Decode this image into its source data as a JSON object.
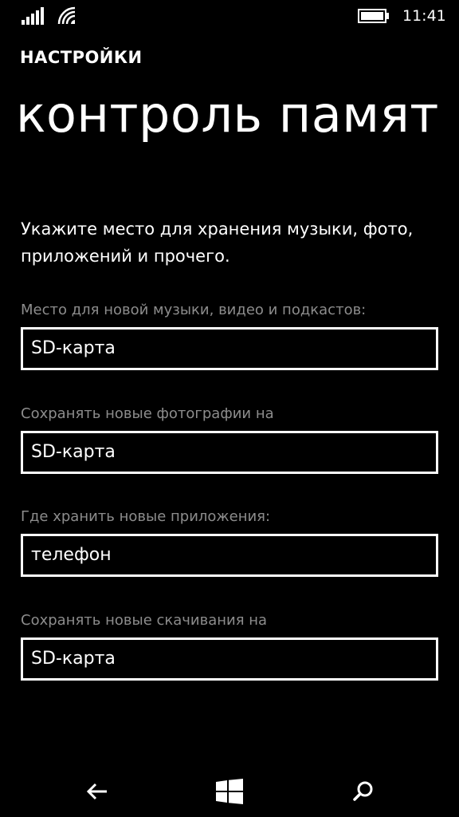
{
  "status_bar": {
    "time": "11:41",
    "icons": [
      "signal-icon",
      "wifi-icon",
      "battery-icon"
    ]
  },
  "header": {
    "app_name": "НАСТРОЙКИ",
    "page_title": "контроль памят"
  },
  "description": "Укажите место для хранения музыки, фото, приложений и прочего.",
  "settings": [
    {
      "label": "Место для новой музыки, видео и подкастов:",
      "value": "SD-карта"
    },
    {
      "label": "Сохранять новые фотографии на",
      "value": "SD-карта"
    },
    {
      "label": "Где хранить новые приложения:",
      "value": "телефон"
    },
    {
      "label": "Сохранять новые скачивания на",
      "value": "SD-карта"
    }
  ],
  "nav_bar": {
    "icons": [
      "back-arrow-icon",
      "windows-logo-icon",
      "search-icon"
    ]
  },
  "colors": {
    "background": "#000000",
    "text": "#ffffff",
    "label": "#8c8c8c"
  }
}
